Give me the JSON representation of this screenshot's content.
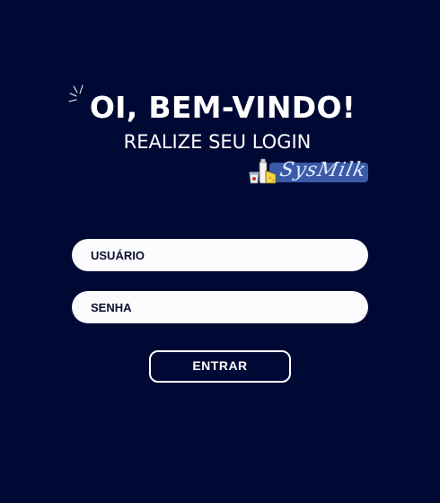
{
  "header": {
    "title": "OI, BEM-VINDO!",
    "subtitle": "REALIZE SEU LOGIN"
  },
  "logo": {
    "text": "SysMilk",
    "icon": "dairy-products-icon",
    "band_color": "#3a5aa8"
  },
  "decoration": {
    "icon": "sparkle-icon"
  },
  "form": {
    "username": {
      "placeholder": "USUÁRIO",
      "value": ""
    },
    "password": {
      "placeholder": "SENHA",
      "value": ""
    },
    "submit_label": "ENTRAR"
  },
  "colors": {
    "background": "#000934",
    "text": "#ffffff",
    "field_background": "#fbfbfd",
    "field_text": "#0a1030"
  }
}
